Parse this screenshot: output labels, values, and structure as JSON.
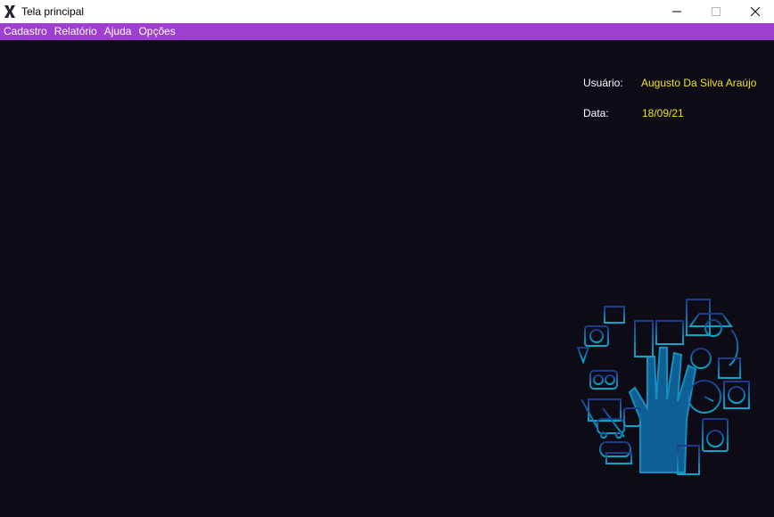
{
  "window": {
    "title": "Tela principal"
  },
  "menu": {
    "items": [
      "Cadastro",
      "Relatório",
      "Ajuda",
      "Opções"
    ]
  },
  "info": {
    "user_label": "Usuário:",
    "user_value": "Augusto Da Silva Araújo",
    "date_label": "Data:",
    "date_value": "18/09/21"
  },
  "theme": {
    "background": "#0d0b15",
    "menubar": "#9e3fd1",
    "value_text": "#f0e021",
    "icon_gradient_top": "#1c3a8a",
    "icon_gradient_bottom": "#0aa6c9"
  },
  "illustration": {
    "icon": "hand-with-home-appliances-icon"
  }
}
